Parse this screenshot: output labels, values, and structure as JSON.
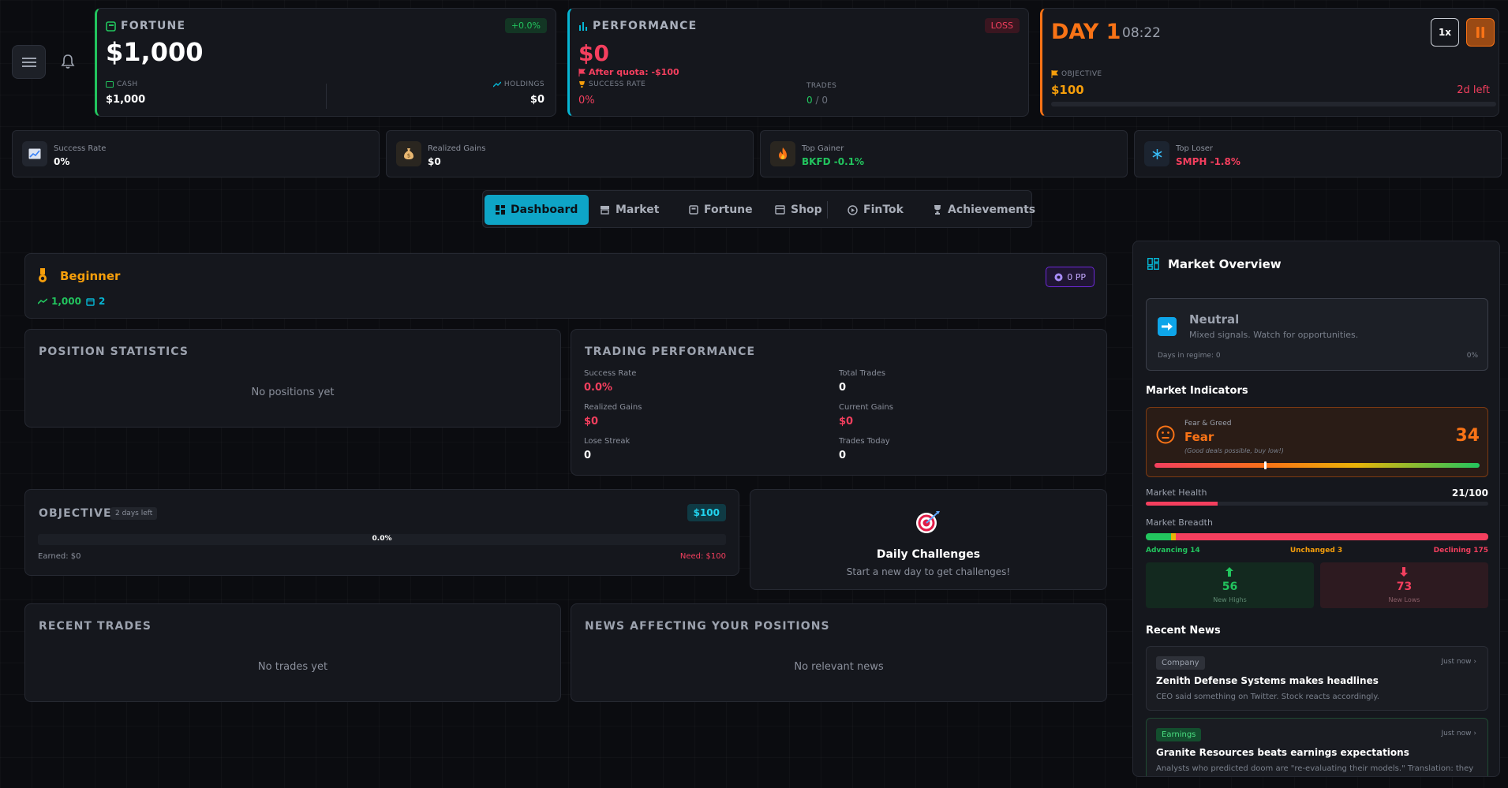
{
  "header": {
    "fortune": {
      "label": "FORTUNE",
      "change": "+0.0%",
      "value": "$1,000",
      "cash_label": "CASH",
      "cash_value": "$1,000",
      "holdings_label": "HOLDINGS",
      "holdings_value": "$0"
    },
    "performance": {
      "label": "PERFORMANCE",
      "status": "LOSS",
      "value": "$0",
      "after_quota": "After quota: -$100",
      "success_label": "SUCCESS RATE",
      "success_value": "0%",
      "trades_label": "TRADES",
      "trades_done": "0",
      "trades_total": "/ 0"
    },
    "day": {
      "label": "DAY 1",
      "time": "08:22",
      "speed": "1x",
      "objective_label": "OBJECTIVE",
      "objective_value": "$100",
      "days_left": "2d left",
      "progress": 0
    }
  },
  "stats": [
    {
      "title": "Success Rate",
      "value": "0%",
      "icon": "chart-icon"
    },
    {
      "title": "Realized Gains",
      "value": "$0",
      "icon": "money-bag-icon"
    },
    {
      "title": "Top Gainer",
      "value": "BKFD -0.1%",
      "icon": "fire-icon"
    },
    {
      "title": "Top Loser",
      "value": "SMPH -1.8%",
      "icon": "snowflake-icon"
    }
  ],
  "nav": {
    "items": [
      "Dashboard",
      "Market",
      "Fortune",
      "Shop",
      "FinTok",
      "Achievements"
    ],
    "active": "Dashboard"
  },
  "rank": {
    "title": "Beginner",
    "points": "0 PP",
    "net_worth": "1,000",
    "days": "2"
  },
  "position_stats": {
    "title": "POSITION STATISTICS",
    "empty": "No positions yet"
  },
  "trading_performance": {
    "title": "TRADING PERFORMANCE",
    "success_rate_label": "Success Rate",
    "success_rate": "0.0%",
    "total_trades_label": "Total Trades",
    "total_trades": "0",
    "realized_gains_label": "Realized Gains",
    "realized_gains": "$0",
    "current_gains_label": "Current Gains",
    "current_gains": "$0",
    "lose_streak_label": "Lose Streak",
    "lose_streak": "0",
    "trades_today_label": "Trades Today",
    "trades_today": "0"
  },
  "objective": {
    "title": "OBJECTIVE",
    "days_left": "2 days left",
    "target": "$100",
    "progress_text": "0.0%",
    "progress": 0,
    "earned": "Earned: $0",
    "need": "Need: $100"
  },
  "daily_challenges": {
    "title": "Daily Challenges",
    "subtitle": "Start a new day to get challenges!"
  },
  "recent_trades": {
    "title": "RECENT TRADES",
    "empty": "No trades yet"
  },
  "news_positions": {
    "title": "NEWS AFFECTING YOUR POSITIONS",
    "empty": "No relevant news"
  },
  "market_overview": {
    "title": "Market Overview",
    "regime": {
      "name": "Neutral",
      "description": "Mixed signals. Watch for opportunities.",
      "days": "Days in regime: 0",
      "percent": "0%"
    },
    "indicators_title": "Market Indicators",
    "fear_greed": {
      "label": "Fear & Greed",
      "state": "Fear",
      "value": 34,
      "note": "(Good deals possible, buy low!)"
    },
    "health": {
      "label": "Market Health",
      "value": "21/100",
      "level": 21
    },
    "breadth": {
      "label": "Market Breadth",
      "advancing": 14,
      "unchanged": 3,
      "declining": 175,
      "advancing_label": "Advancing 14",
      "unchanged_label": "Unchanged 3",
      "declining_label": "Declining 175"
    },
    "highs": {
      "value": "56",
      "label": "New Highs"
    },
    "lows": {
      "value": "73",
      "label": "New Lows"
    },
    "news_title": "Recent News",
    "news": [
      {
        "tag": "Company",
        "time": "Just now",
        "title": "Zenith Defense Systems makes headlines",
        "desc": "CEO said something on Twitter. Stock reacts accordingly."
      },
      {
        "tag": "Earnings",
        "time": "Just now",
        "title": "Granite Resources beats earnings expectations",
        "desc": "Analysts who predicted doom are \"re-evaluating their models.\" Translation: they were wrong. Again."
      }
    ]
  },
  "colors": {
    "green": "#22c55e",
    "red": "#f43f5e",
    "orange": "#f97316",
    "cyan": "#06b6d4",
    "amber": "#f59e0b"
  }
}
